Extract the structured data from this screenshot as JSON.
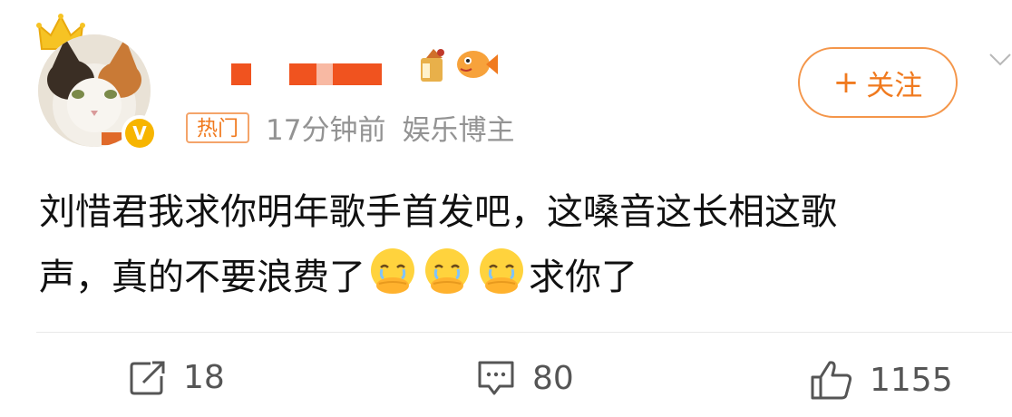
{
  "user": {
    "name_masked": true,
    "avatar": "cat-avatar",
    "verified_badge": "V",
    "crown": "crown-icon",
    "name_icons": [
      "drink-icon",
      "fish-icon"
    ]
  },
  "follow_button": {
    "plus": "+",
    "label": "关注"
  },
  "meta": {
    "hot_badge": "热门",
    "time": "17分钟前",
    "role": "娱乐博主"
  },
  "post": {
    "line1": "刘惜君我求你明年歌手首发吧，这嗓音这长相这歌",
    "line2_prefix": "声，真的不要浪费了",
    "emojis": [
      "crying-emoji",
      "crying-emoji",
      "crying-emoji"
    ],
    "line2_suffix": "求你了"
  },
  "actions": {
    "repost": {
      "icon": "repost-icon",
      "count": "18"
    },
    "comment": {
      "icon": "comment-icon",
      "count": "80"
    },
    "like": {
      "icon": "like-icon",
      "count": "1155"
    }
  },
  "colors": {
    "accent": "#f07a1f",
    "meta": "#939393",
    "mask": "#f0531f"
  }
}
